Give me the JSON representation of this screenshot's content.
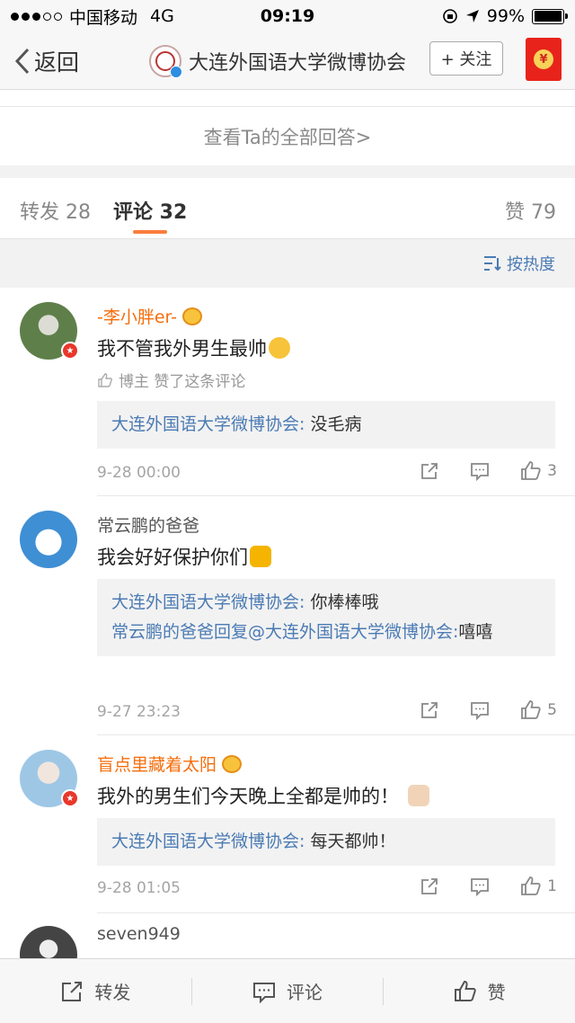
{
  "status_bar": {
    "carrier": "中国移动",
    "network": "4G",
    "time": "09:19",
    "battery": "99%",
    "battery_level": 0.99
  },
  "nav": {
    "back_label": "返回",
    "title": "大连外国语大学微博协会",
    "follow_label": "+ 关注",
    "redpacket_icon": "redpacket-icon",
    "redpacket_glyph": "¥"
  },
  "view_all": {
    "label": "查看Ta的全部回答>"
  },
  "tabs": {
    "repost": "转发 28",
    "comment": "评论 32",
    "like": "赞 79"
  },
  "sort": {
    "label": "按热度"
  },
  "comments": [
    {
      "username": "-李小胖er-",
      "text": "我不管我外男生最帅",
      "liked_by": "博主 赞了这条评论",
      "replies": [
        {
          "author": "大连外国语大学微博协会:",
          "body": " 没毛病"
        }
      ],
      "time": "9-28 00:00",
      "likes": "3"
    },
    {
      "username": "常云鹏的爸爸",
      "text": "我会好好保护你们",
      "replies": [
        {
          "author": "大连外国语大学微博协会:",
          "body": " 你棒棒哦"
        },
        {
          "author": "常云鹏的爸爸回复@大连外国语大学微博协会:",
          "body": "嘻嘻"
        }
      ],
      "time": "9-27 23:23",
      "likes": "5"
    },
    {
      "username": "盲点里藏着太阳",
      "text": "我外的男生们今天晚上全都是帅的！",
      "replies": [
        {
          "author": "大连外国语大学微博协会:",
          "body": " 每天都帅！"
        }
      ],
      "time": "9-28 01:05",
      "likes": "1"
    },
    {
      "username": "seven949",
      "text": ""
    }
  ],
  "toolbar": {
    "repost": "转发",
    "comment": "评论",
    "like": "赞"
  },
  "colors": {
    "accent": "#fa7d3c",
    "link": "#4b7bb4",
    "vip_name": "#f56e0c"
  }
}
